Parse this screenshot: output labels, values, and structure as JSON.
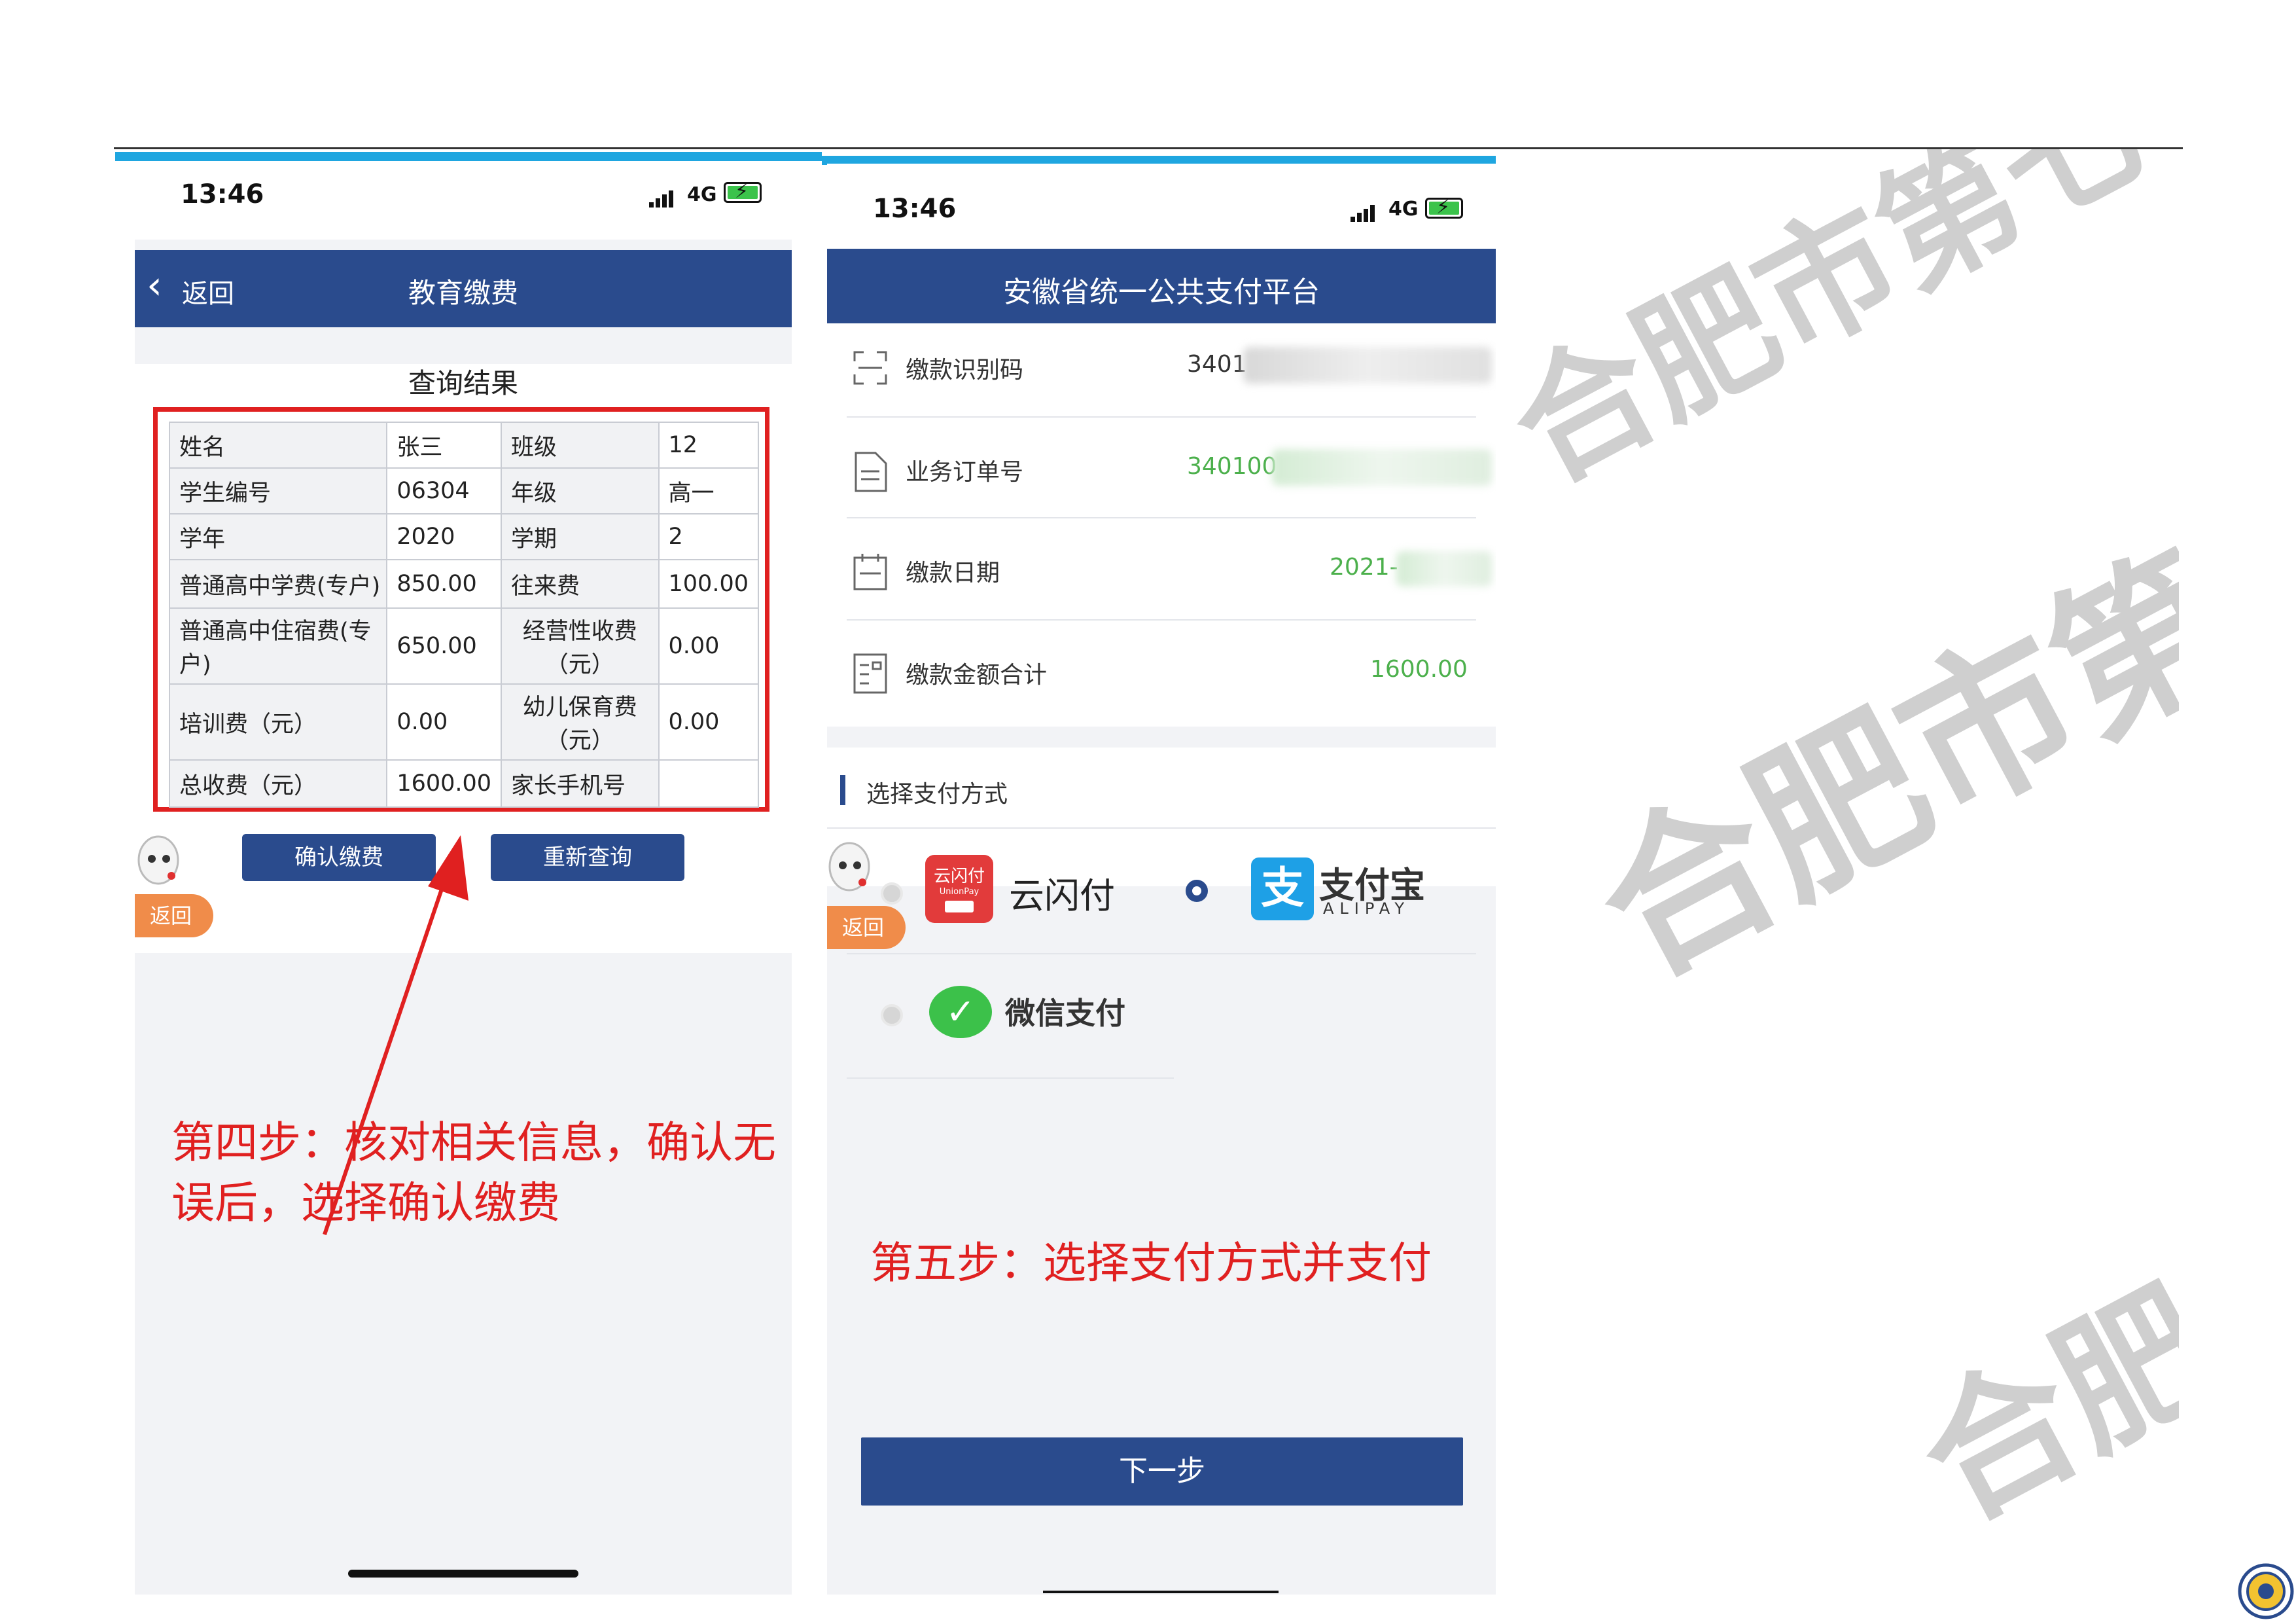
{
  "left_phone": {
    "status": {
      "time": "13:46",
      "network": "4G"
    },
    "nav": {
      "back_label": "返回",
      "title": "教育缴费"
    },
    "section_title": "查询结果",
    "table": [
      [
        "姓名",
        "张三",
        "班级",
        "12"
      ],
      [
        "学生编号",
        "06304",
        "年级",
        "高一"
      ],
      [
        "学年",
        "2020",
        "学期",
        "2"
      ],
      [
        "普通高中学费(专户)",
        "850.00",
        "往来费",
        "100.00"
      ],
      [
        "普通高中住宿费(专户)",
        "650.00",
        "经营性收费（元）",
        "0.00"
      ],
      [
        "培训费（元）",
        "0.00",
        "幼儿保育费（元）",
        "0.00"
      ],
      [
        "总收费（元）",
        "1600.00",
        "家长手机号",
        ""
      ]
    ],
    "confirm_button": "确认缴费",
    "requery_button": "重新查询",
    "float_back": "返回"
  },
  "step4_note": "第四步：核对相关信息，确认无误后，选择确认缴费",
  "right_phone": {
    "status": {
      "time": "13:46",
      "network": "4G"
    },
    "nav": {
      "title": "安徽省统一公共支付平台"
    },
    "rows": [
      {
        "label": "缴款识别码",
        "value": "3401"
      },
      {
        "label": "业务订单号",
        "value": "340100"
      },
      {
        "label": "缴款日期",
        "value": "2021-"
      },
      {
        "label": "缴款金额合计",
        "value": "1600.00"
      }
    ],
    "pay_section_title": "选择支付方式",
    "pay_methods": [
      {
        "name": "云闪付",
        "logo_text": "云闪付",
        "logo_sub": "UnionPay",
        "selected": false
      },
      {
        "name": "支付宝",
        "logo_sub": "ALIPAY",
        "selected": true
      },
      {
        "name": "微信支付",
        "selected": false
      }
    ],
    "float_back": "返回",
    "next_button": "下一步"
  },
  "step5_note": "第五步：选择支付方式并支付",
  "watermark": "合肥市第七",
  "colors": {
    "nav_blue": "#2a4b8d",
    "accent_red": "#e02020",
    "value_green": "#4cb04c",
    "top_bar_blue": "#1fa6e0"
  }
}
